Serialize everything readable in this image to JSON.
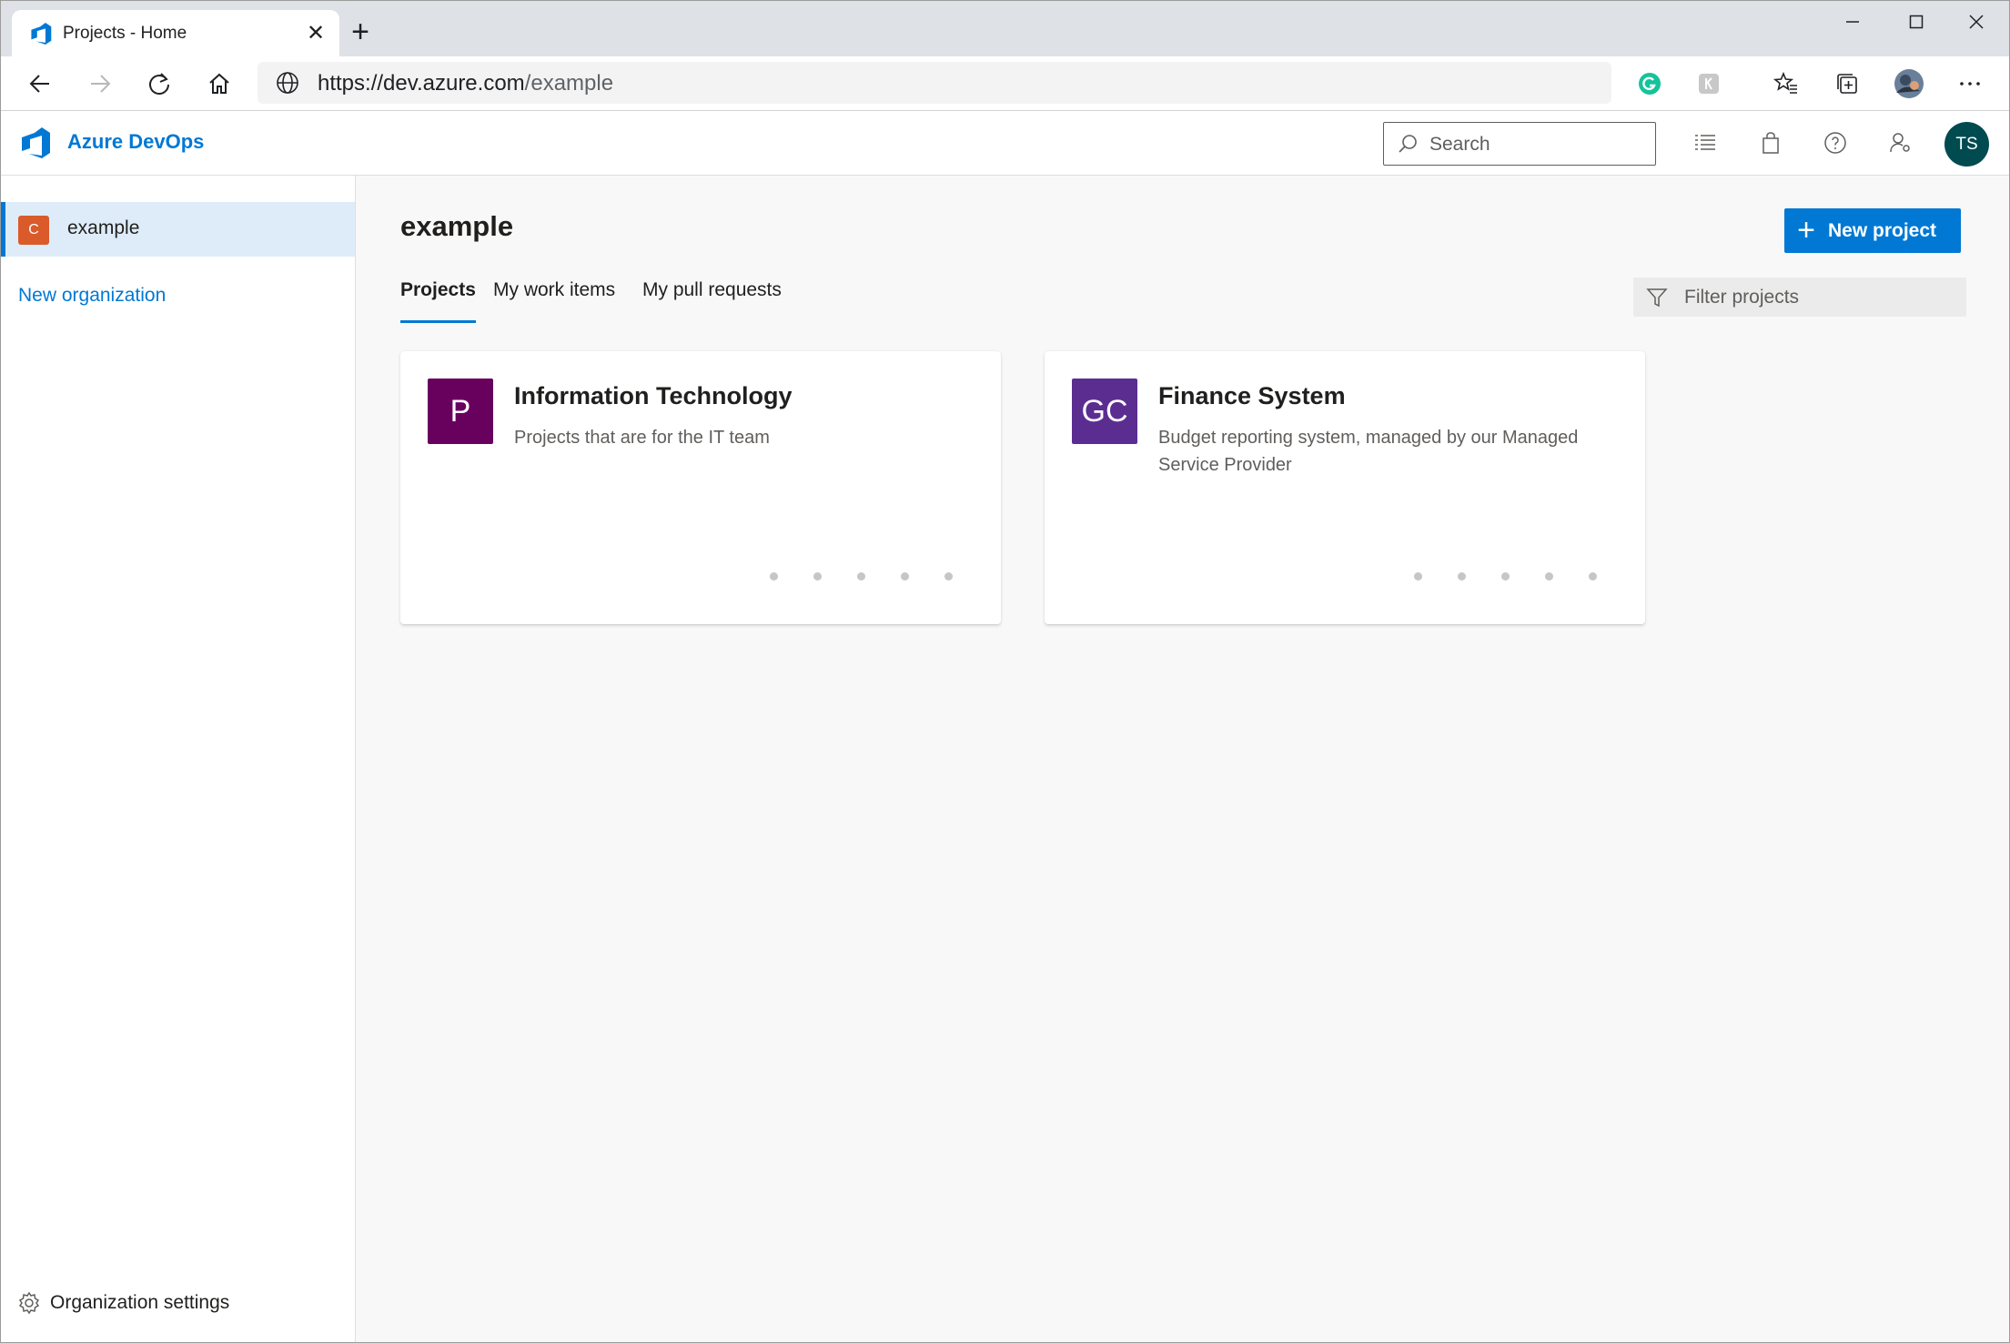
{
  "browser": {
    "tab_title": "Projects - Home",
    "url_host": "https://dev.azure.com",
    "url_path": "/example"
  },
  "header": {
    "brand": "Azure DevOps",
    "search_placeholder": "Search",
    "avatar_initials": "TS"
  },
  "sidebar": {
    "org": {
      "badge": "C",
      "name": "example",
      "badge_color": "#da5a2a"
    },
    "new_org": "New organization",
    "settings": "Organization settings"
  },
  "main": {
    "title": "example",
    "new_project": "New project",
    "tabs": [
      {
        "label": "Projects",
        "active": true
      },
      {
        "label": "My work items",
        "active": false
      },
      {
        "label": "My pull requests",
        "active": false
      }
    ],
    "filter_placeholder": "Filter projects",
    "projects": [
      {
        "badge": "P",
        "badge_color": "#68005e",
        "name": "Information Technology",
        "description": "Projects that are for the IT team"
      },
      {
        "badge": "GC",
        "badge_color": "#5c2d91",
        "name": "Finance System",
        "description": "Budget reporting system, managed by our Managed Service Provider"
      }
    ]
  },
  "colors": {
    "accent": "#0078d4"
  }
}
